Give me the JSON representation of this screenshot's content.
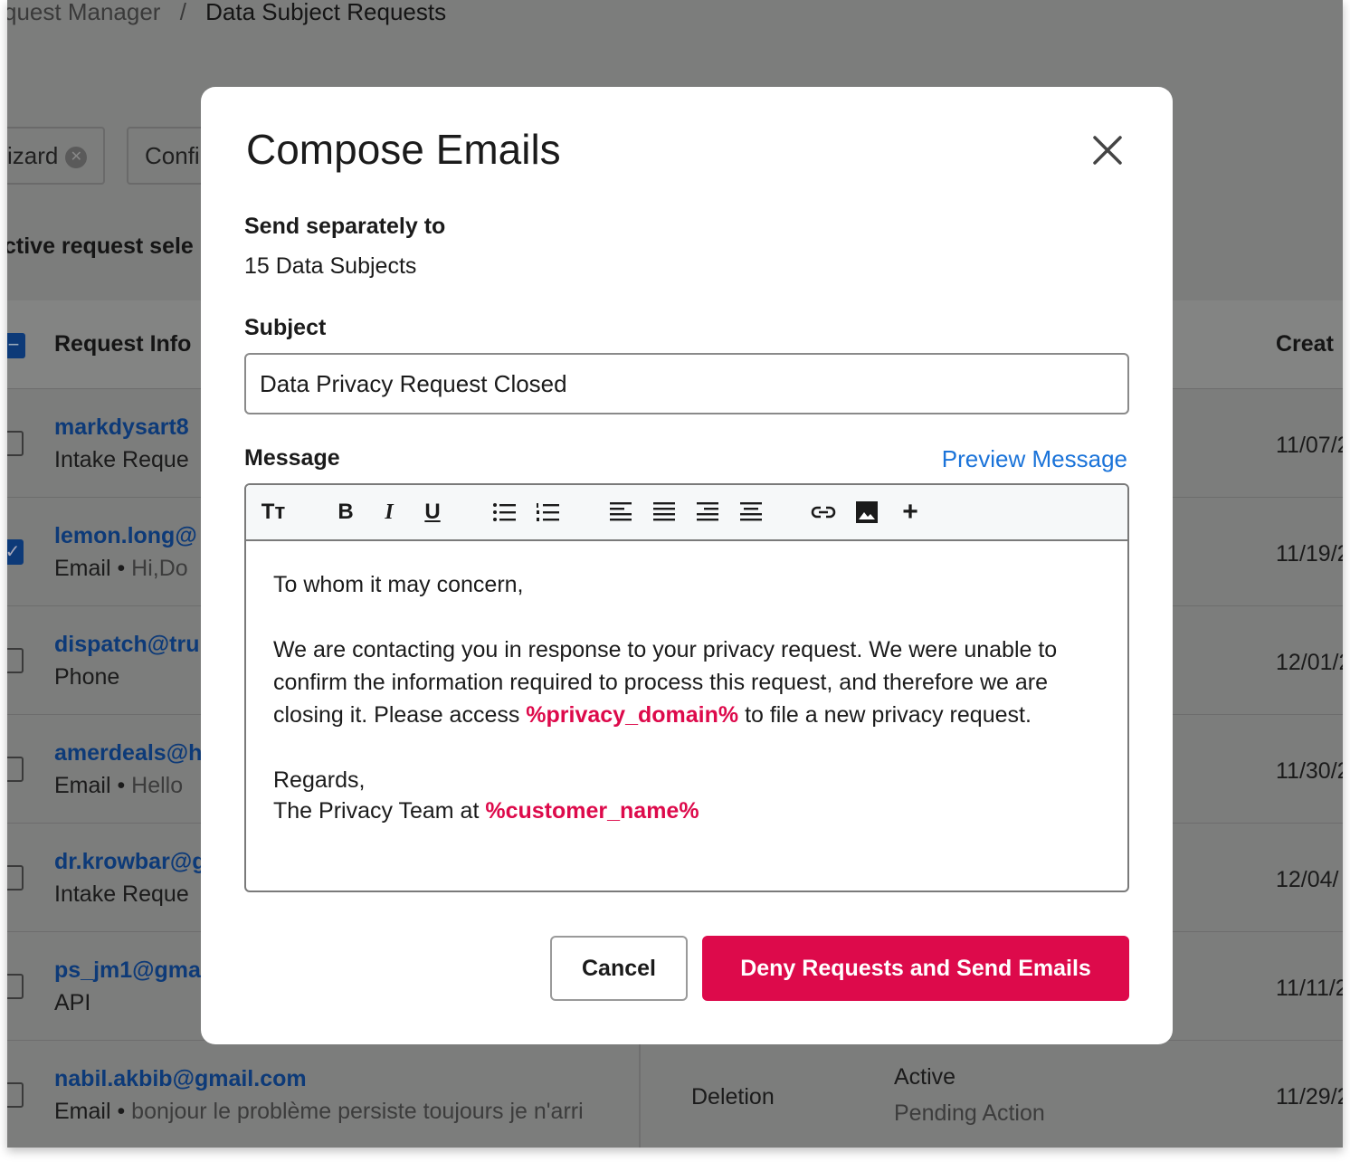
{
  "breadcrumb": {
    "parent": "quest Manager",
    "separator": "/",
    "current": "Data Subject Requests"
  },
  "filters": [
    {
      "label": "izard"
    },
    {
      "label": "Confi"
    }
  ],
  "selection_text": "ctive request sele",
  "table": {
    "headers": {
      "request_info": "Request Info",
      "created": "Creat"
    },
    "rows": [
      {
        "email": "markdysart8",
        "source": "Intake Reque",
        "detail": "",
        "date": "11/07/2",
        "checked": false
      },
      {
        "email": "lemon.long@",
        "source": "Email",
        "detail": "Hi,Do",
        "date": "11/19/2",
        "checked": true
      },
      {
        "email": "dispatch@tru",
        "source": "Phone",
        "detail": "",
        "date": "12/01/2",
        "checked": false
      },
      {
        "email": "amerdeals@h",
        "source": "Email",
        "detail": "Hello",
        "date": "11/30/2",
        "checked": false
      },
      {
        "email": "dr.krowbar@g",
        "source": "Intake Reque",
        "detail": "",
        "date": "12/04/",
        "checked": false
      },
      {
        "email": "ps_jm1@gma",
        "source": "API",
        "detail": "",
        "date": "11/11/2",
        "checked": false
      },
      {
        "email": "nabil.akbib@gmail.com",
        "source": "Email",
        "detail": "bonjour le problème persiste toujours je n'arri",
        "type": "Deletion",
        "status": "Active",
        "substatus": "Pending Action",
        "date": "11/29/2",
        "checked": false
      }
    ]
  },
  "modal": {
    "title": "Compose Emails",
    "send_label": "Send separately to",
    "send_value": "15 Data Subjects",
    "subject_label": "Subject",
    "subject_value": "Data Privacy Request Closed",
    "message_label": "Message",
    "preview_link": "Preview Message",
    "toolbar": {
      "text_size": "Tт",
      "bold": "B",
      "italic": "I",
      "underline": "U",
      "add": "+"
    },
    "message": {
      "greeting": "To whom it may concern,",
      "p1a": "We are contacting you in response to your privacy request. We were unable to confirm the information required to process this request, and therefore we are closing it. Please access ",
      "var1": "%privacy_domain%",
      "p1b": " to file a new privacy request.",
      "regards": "Regards,",
      "sign": "The Privacy Team at ",
      "var2": "%customer_name%"
    },
    "cancel_label": "Cancel",
    "deny_label": "Deny Requests and Send Emails"
  },
  "colors": {
    "accent": "#dd0a4b",
    "link": "#1a73d9",
    "overlay": "#7c7d7c"
  }
}
